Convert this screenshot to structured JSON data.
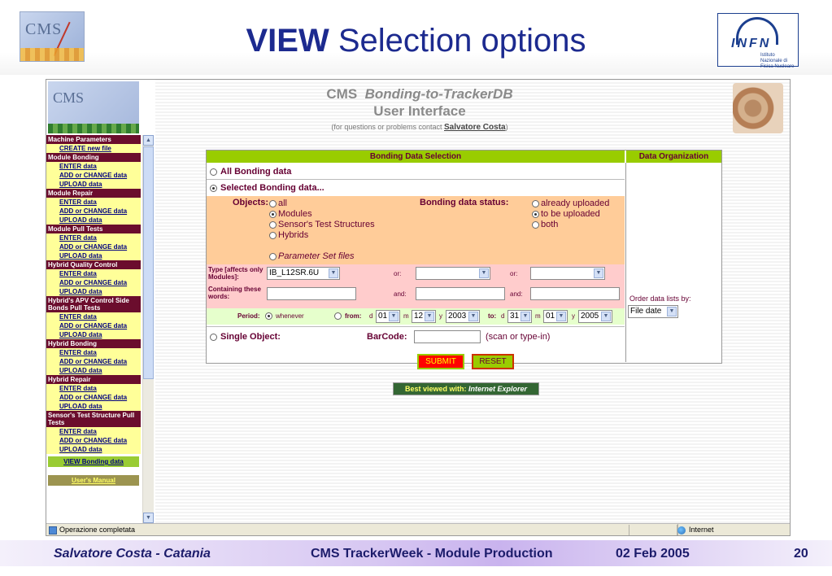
{
  "slide": {
    "title_bold": "VIEW",
    "title_rest": "Selection options",
    "cms_logo_text": "CMS",
    "infn_logo_text": "INFN",
    "infn_logo_sub": "Istituto Nazionale di Fisica Nucleare"
  },
  "app": {
    "title_prefix": "CMS",
    "title_italic": "Bonding-to-TrackerDB",
    "title_line2": "User Interface",
    "contact_text": "(for questions or problems contact",
    "contact_name": "Salvatore Costa",
    "contact_close": ")"
  },
  "sidebar": {
    "logo_text": "CMS",
    "sections": [
      {
        "header": "Machine Parameters",
        "items": [
          "CREATE new file"
        ]
      },
      {
        "header": "Module Bonding",
        "items": [
          "ENTER data",
          "ADD or CHANGE data",
          "UPLOAD data"
        ]
      },
      {
        "header": "Module Repair",
        "items": [
          "ENTER data",
          "ADD or CHANGE data",
          "UPLOAD data"
        ]
      },
      {
        "header": "Module Pull Tests",
        "items": [
          "ENTER data",
          "ADD or CHANGE data",
          "UPLOAD data"
        ]
      },
      {
        "header": "Hybrid Quality Control",
        "items": [
          "ENTER data",
          "ADD or CHANGE data",
          "UPLOAD data"
        ]
      },
      {
        "header": "Hybrid's APV Control Side Bonds Pull Tests",
        "items": [
          "ENTER data",
          "ADD or CHANGE data",
          "UPLOAD data"
        ]
      },
      {
        "header": "Hybrid Bonding",
        "items": [
          "ENTER data",
          "ADD or CHANGE data",
          "UPLOAD data"
        ]
      },
      {
        "header": "Hybrid Repair",
        "items": [
          "ENTER data",
          "ADD or CHANGE data",
          "UPLOAD data"
        ]
      },
      {
        "header": "Sensor's Test Structure Pull Tests",
        "items": [
          "ENTER data",
          "ADD or CHANGE data",
          "UPLOAD data"
        ]
      }
    ],
    "view_button": "VIEW Bonding data",
    "manual_button": "User's Manual"
  },
  "panel": {
    "selection_header": "Bonding Data Selection",
    "organization_header": "Data Organization",
    "all_label": "All Bonding data",
    "selected_label": "Selected Bonding data...",
    "objects_label": "Objects:",
    "objects_options": [
      "all",
      "Modules",
      "Sensor's Test Structures",
      "Hybrids",
      "Parameter Set files"
    ],
    "objects_selected": "Modules",
    "status_label": "Bonding data status:",
    "status_options": [
      "already uploaded",
      "to be uploaded",
      "both"
    ],
    "status_selected": "to be uploaded",
    "type_label": "Type [affects only Modules]:",
    "type_value": "IB_L12SR.6U",
    "or_label": "or:",
    "words_label": "Containing these words:",
    "and_label": "and:",
    "period_label": "Period:",
    "period_whenever": "whenever",
    "period_from": "from:",
    "from": {
      "d": "01",
      "m": "12",
      "y": "2003"
    },
    "period_to": "to:",
    "to": {
      "d": "31",
      "m": "01",
      "y": "2005"
    },
    "d_label": "d",
    "m_label": "m",
    "y_label": "y",
    "single_label": "Single Object:",
    "barcode_label": "BarCode:",
    "barcode_hint": "(scan or type-in)",
    "order_label": "Order data lists by:",
    "order_value": "File date"
  },
  "buttons": {
    "submit": "SUBMIT",
    "reset": "RESET",
    "best_viewed_prefix": "Best viewed with:",
    "best_viewed_browser": "Internet Explorer"
  },
  "statusbar": {
    "text": "Operazione completata",
    "zone": "Internet"
  },
  "footer": {
    "author": "Salvatore Costa - Catania",
    "event": "CMS TrackerWeek - Module Production",
    "date": "02 Feb 2005",
    "page": "20"
  }
}
